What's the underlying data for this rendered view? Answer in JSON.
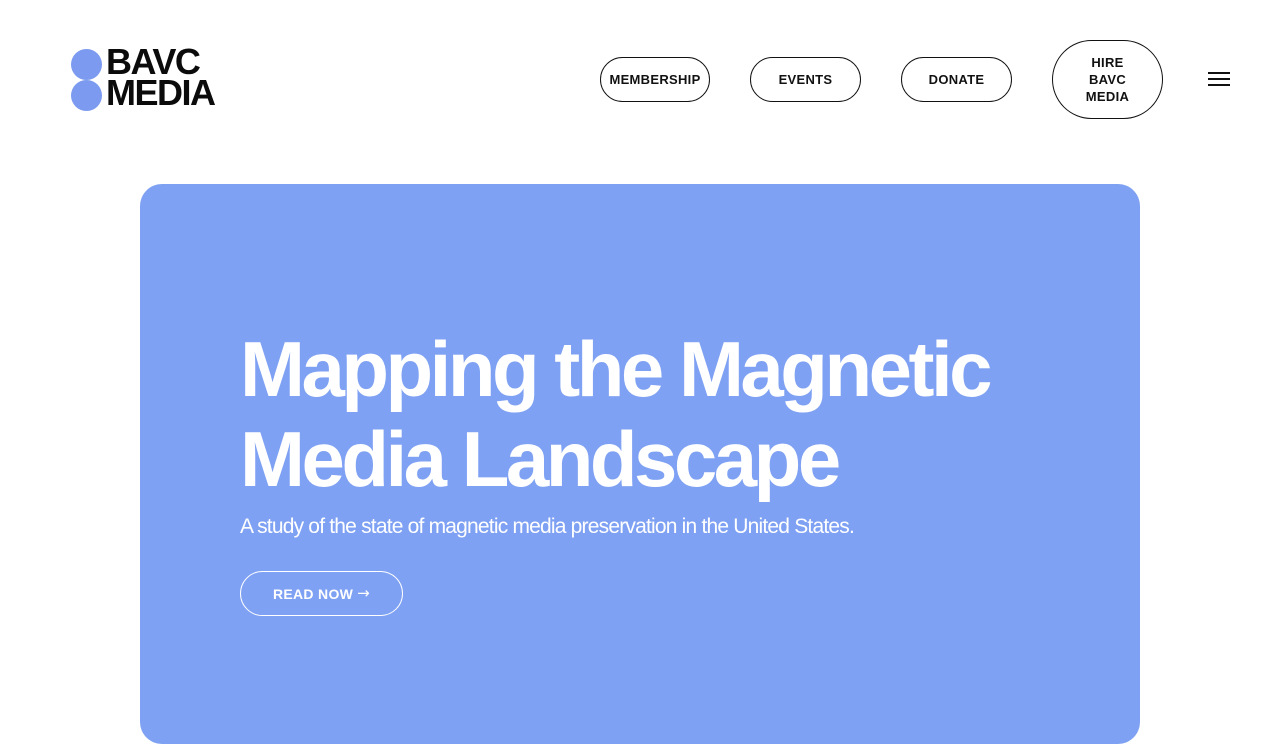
{
  "header": {
    "logo": {
      "line1": "BAVC",
      "line2": "MEDIA",
      "dot_color": "#7b9af0"
    },
    "nav": [
      {
        "label": "MEMBERSHIP"
      },
      {
        "label": "EVENTS"
      },
      {
        "label": "DONATE"
      },
      {
        "label": "HIRE\nBAVC\nMEDIA"
      }
    ],
    "menu_icon": "hamburger-menu-icon"
  },
  "hero": {
    "background_color": "#7fa1f3",
    "title_line1": "Mapping the Magnetic",
    "title_line2": "Media Landscape",
    "subtitle": "A study of the state of magnetic media preservation in the United States.",
    "cta": {
      "label": "READ NOW",
      "icon": "arrow-right-icon",
      "arrow": "→"
    }
  }
}
